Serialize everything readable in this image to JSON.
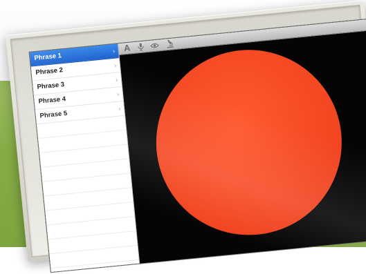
{
  "sidebar": {
    "items": [
      {
        "label": "Phrase 1",
        "selected": true
      },
      {
        "label": "Phrase 2",
        "selected": false
      },
      {
        "label": "Phrase 3",
        "selected": false
      },
      {
        "label": "Phrase 4",
        "selected": false
      },
      {
        "label": "Phrase 5",
        "selected": false
      }
    ],
    "chevron": "›"
  },
  "toolbar": {
    "tools": [
      {
        "icon": "text-icon",
        "glyph": "A"
      },
      {
        "icon": "microphone-icon"
      },
      {
        "icon": "eye-icon"
      },
      {
        "icon": "microscope-icon"
      }
    ]
  },
  "canvas": {
    "background_color": "#050505",
    "circle_color": "#f24420"
  },
  "colors": {
    "selection": "#2a73dd",
    "background_green": "#86ad45"
  }
}
